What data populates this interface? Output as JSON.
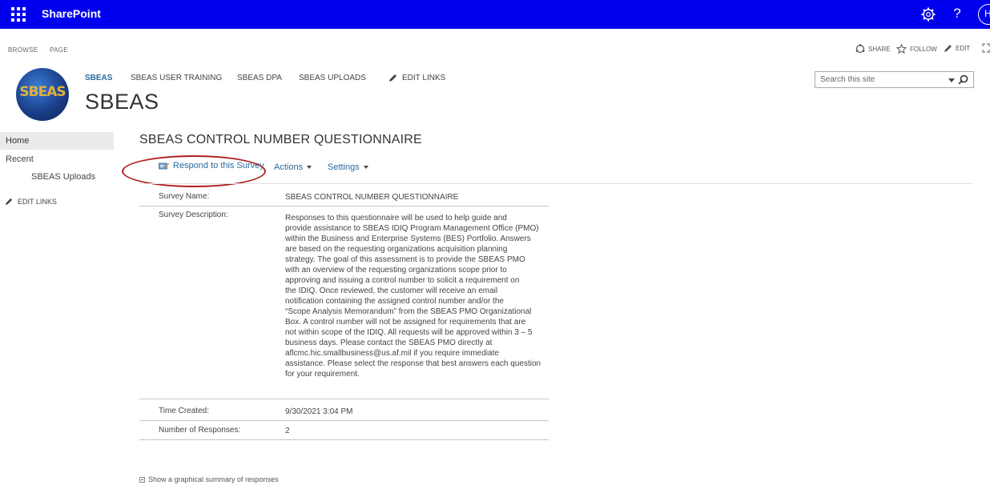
{
  "suite_bar": {
    "app_name": "SharePoint",
    "avatar_initial": "H",
    "help_label": "?",
    "background": "#0000ee"
  },
  "ribbon": {
    "tabs": [
      "BROWSE",
      "PAGE"
    ],
    "actions": [
      "SHARE",
      "FOLLOW",
      "EDIT"
    ]
  },
  "site": {
    "logo_text": "SBEAS",
    "title": "SBEAS",
    "nav": [
      "SBEAS",
      "SBEAS USER TRAINING",
      "SBEAS DPA",
      "SBEAS UPLOADS",
      "EDIT LINKS"
    ],
    "search_placeholder": "Search this site"
  },
  "left_nav": {
    "home": "Home",
    "recent": "Recent",
    "recent_items": [
      "SBEAS Uploads"
    ],
    "edit_links": "EDIT LINKS"
  },
  "page": {
    "title": "SBEAS CONTROL NUMBER QUESTIONNAIRE",
    "toolbar": {
      "respond": "Respond to this Survey",
      "actions": "Actions",
      "settings": "Settings"
    },
    "details": {
      "survey_name_label": "Survey Name:",
      "survey_name": "SBEAS CONTROL NUMBER QUESTIONNAIRE",
      "description_label": "Survey Description:",
      "description_lines": [
        "Responses to this questionnaire will be used to help guide and",
        "provide assistance to SBEAS IDIQ Program Management Office (PMO)",
        "within the Business and Enterprise Systems (BES) Portfolio. Answers",
        "are based on the requesting organizations acquisition planning",
        "strategy. The goal of this assessment is to provide the SBEAS PMO",
        "with an overview of the requesting organizations scope prior to",
        "approving and issuing a control number to solicit a requirement on",
        "the IDIQ. Once reviewed, the customer will receive an email",
        "notification containing the assigned control number and/or the",
        "“Scope Analysis Memorandum” from the SBEAS PMO Organizational",
        "Box. A control number will not be assigned for requirements that are",
        "not within scope of the IDIQ. All requests will be approved within 3 – 5",
        "business days. Please contact the SBEAS PMO directly at",
        "aflcmc.hic.smallbusiness@us.af.mil if you require immediate",
        "assistance. Please select the response that best answers each question",
        "for your requirement."
      ],
      "time_created_label": "Time Created:",
      "time_created": "9/30/2021 3:04 PM",
      "responses_label": "Number of Responses:",
      "responses": "2"
    },
    "summary_link": "Show a graphical summary of responses"
  },
  "colors": {
    "link": "#2a6a9e",
    "highlight_oval": "#b01f1f"
  }
}
